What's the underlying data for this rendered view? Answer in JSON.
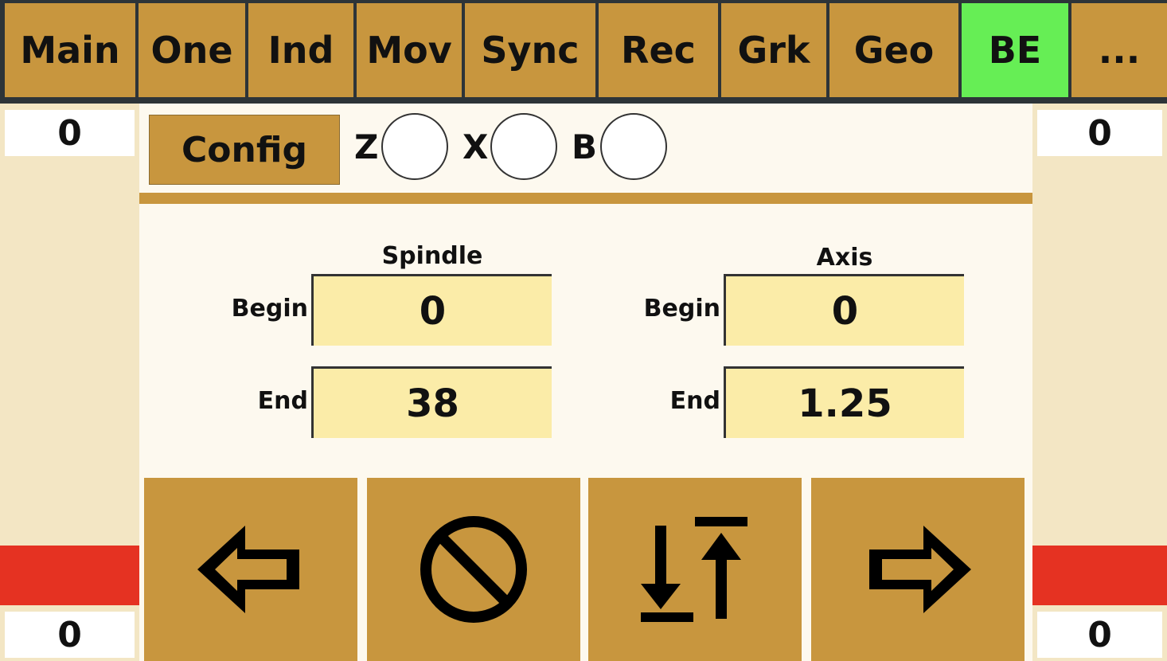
{
  "tabs": [
    {
      "label": "Main"
    },
    {
      "label": "One"
    },
    {
      "label": "Ind"
    },
    {
      "label": "Mov"
    },
    {
      "label": "Sync"
    },
    {
      "label": "Rec"
    },
    {
      "label": "Grk"
    },
    {
      "label": "Geo"
    },
    {
      "label": "BE",
      "active": true
    },
    {
      "label": "..."
    }
  ],
  "left": {
    "top_counter": "0",
    "bottom_counter": "0"
  },
  "right": {
    "top_counter": "0",
    "bottom_counter": "0"
  },
  "header": {
    "config_label": "Config",
    "axes": [
      {
        "label": "Z"
      },
      {
        "label": "X"
      },
      {
        "label": "B"
      }
    ]
  },
  "spindle": {
    "title": "Spindle",
    "begin_label": "Begin",
    "begin_value": "0",
    "end_label": "End",
    "end_value": "38"
  },
  "axis": {
    "title": "Axis",
    "begin_label": "Begin",
    "begin_value": "0",
    "end_label": "End",
    "end_value": "1.25"
  },
  "buttons": {
    "prev_icon": "arrow-left-icon",
    "cancel_icon": "cancel-icon",
    "swap_icon": "swap-up-down-icon",
    "next_icon": "arrow-right-icon"
  },
  "colors": {
    "tab": "#c8963e",
    "active_tab": "#66ee55",
    "field": "#fbeca8",
    "alarm": "#e53222"
  }
}
